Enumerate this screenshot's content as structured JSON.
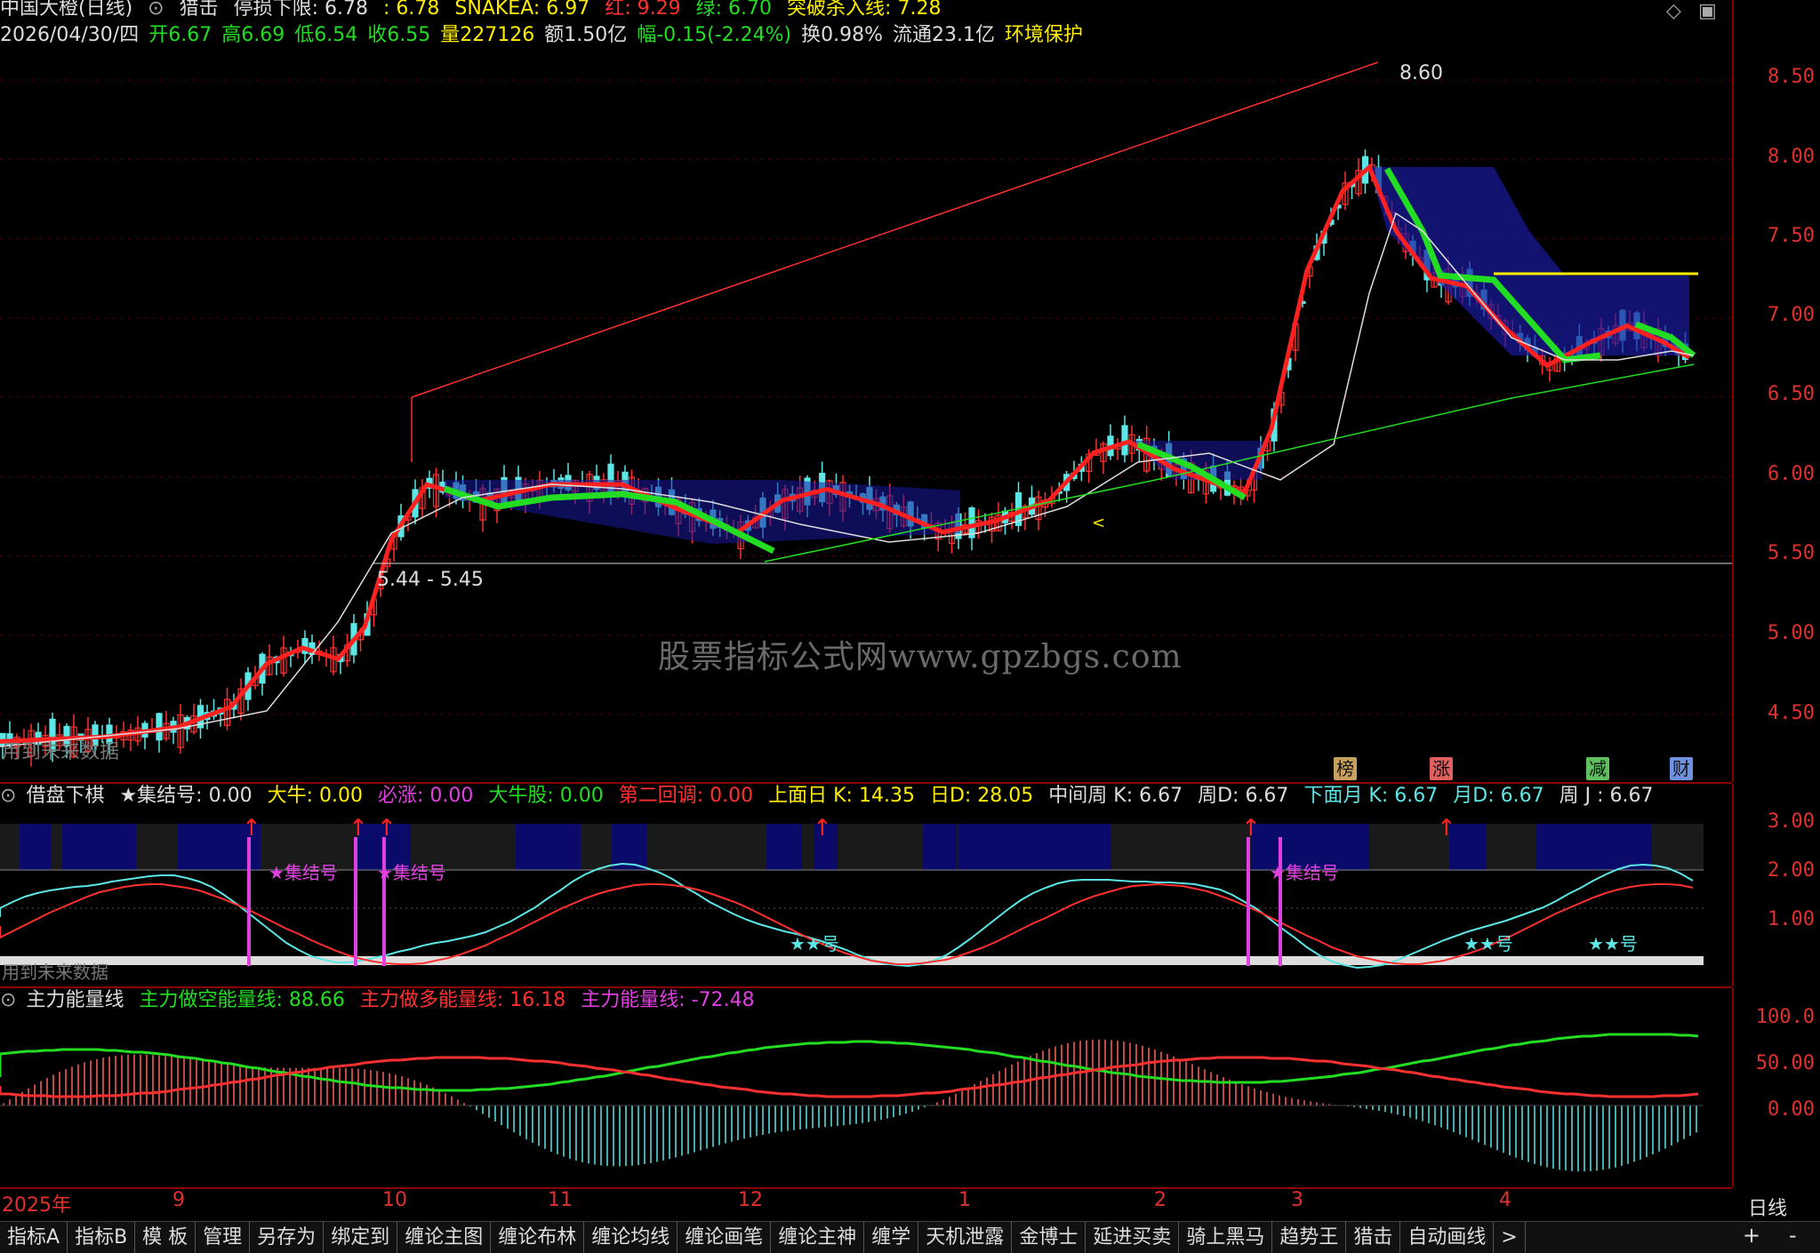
{
  "main_header": {
    "title": "中国大橙(日线)",
    "indicator": "猎击",
    "stop_loss": "停损下限: 6.78",
    "v2": ": 6.78",
    "snakea": "SNAKEA: 6.97",
    "red": "红: 9.29",
    "green": "绿: 6.70",
    "break_line": "突破杀入线: 7.28"
  },
  "quote_line": {
    "date": "2026/04/30/四",
    "open": "开6.67",
    "high": "高6.69",
    "low": "低6.54",
    "close": "收6.55",
    "vol": "量227126",
    "amount": "额1.50亿",
    "range": "幅-0.15(-2.24%)",
    "turnover": "换0.98%",
    "float": "流通23.1亿",
    "tag": "环境保护"
  },
  "main_annotations": {
    "high_label": "8.60",
    "range_label": "5.44 - 5.45",
    "left_note": "用到未来数据",
    "mid_note": "<"
  },
  "main_y_ticks": [
    "8.50",
    "8.00",
    "7.50",
    "7.00",
    "6.50",
    "6.00",
    "5.50",
    "5.00",
    "4.50"
  ],
  "badges": [
    {
      "text": "榜",
      "color": "#c8a060"
    },
    {
      "text": "涨",
      "color": "#e06060"
    },
    {
      "text": "减",
      "color": "#60c060"
    },
    {
      "text": "财",
      "color": "#7090e0"
    }
  ],
  "watermark": "股票指标公式网www.gpzbgs.com",
  "pane2_header": {
    "name": "借盘下棋",
    "jijiehao": "★集结号: 0.00",
    "daniu": "大牛: 0.00",
    "bizhang": "必涨: 0.00",
    "daniugu": "大牛股: 0.00",
    "second_pullback": "第二回调: 0.00",
    "day_k": "上面日 K: 14.35",
    "day_d": "日D: 28.05",
    "week_k": "中间周 K: 6.67",
    "week_d": "周D: 6.67",
    "month_k": "下面月 K: 6.67",
    "month_d": "月D: 6.67",
    "week_j": "周 J : 6.67"
  },
  "pane2_labels": {
    "star1": "★集结号",
    "star2": "★集结号",
    "star3": "★集结号",
    "stars_a": "★★号",
    "stars_b": "★★号",
    "stars_c": "★★号",
    "note": "用到未来数据"
  },
  "pane2_y_ticks": [
    "3.00",
    "2.00",
    "1.00"
  ],
  "pane3_header": {
    "name": "主力能量线",
    "short": "主力做空能量线: 88.66",
    "long": "主力做多能量线: 16.18",
    "main": "主力能量线: -72.48"
  },
  "pane3_y_ticks": [
    "100.0",
    "50.00",
    "0.00"
  ],
  "x_axis": [
    "2025年",
    "9",
    "10",
    "11",
    "12",
    "1",
    "2",
    "3",
    "4"
  ],
  "period": "日线",
  "tabs": [
    "指标A",
    "指标B",
    "模 板",
    "管理",
    "另存为",
    "绑定到",
    "缠论主图",
    "缠论布林",
    "缠论均线",
    "缠论画笔",
    "缠论主神",
    "缠学",
    "天机泄露",
    "金博士",
    "延进买卖",
    "骑上黑马",
    "趋势王",
    "猎击",
    "自动画线",
    ">"
  ],
  "right_tools": [
    "+",
    "-"
  ],
  "colors": {
    "up": "#ff3030",
    "down": "#5ce6e6",
    "ma_red": "#ff2020",
    "ma_green": "#22dd22",
    "yellow": "#ffee00",
    "magenta": "#e040e0",
    "cloud": "#1a1aa0",
    "axis_red": "#8b0000"
  },
  "chart_data": {
    "type": "line",
    "title": "中国大橙(日线)",
    "ylim": [
      4.2,
      8.7
    ],
    "x": [
      "2025-08",
      "2025-09",
      "2025-10",
      "2025-11",
      "2025-12",
      "2026-01",
      "2026-02",
      "2026-03",
      "2026-04"
    ],
    "series": [
      {
        "name": "收",
        "values": [
          4.35,
          4.6,
          5.9,
          5.95,
          5.7,
          5.65,
          6.2,
          5.9,
          7.9,
          7.0,
          6.55
        ]
      }
    ]
  }
}
